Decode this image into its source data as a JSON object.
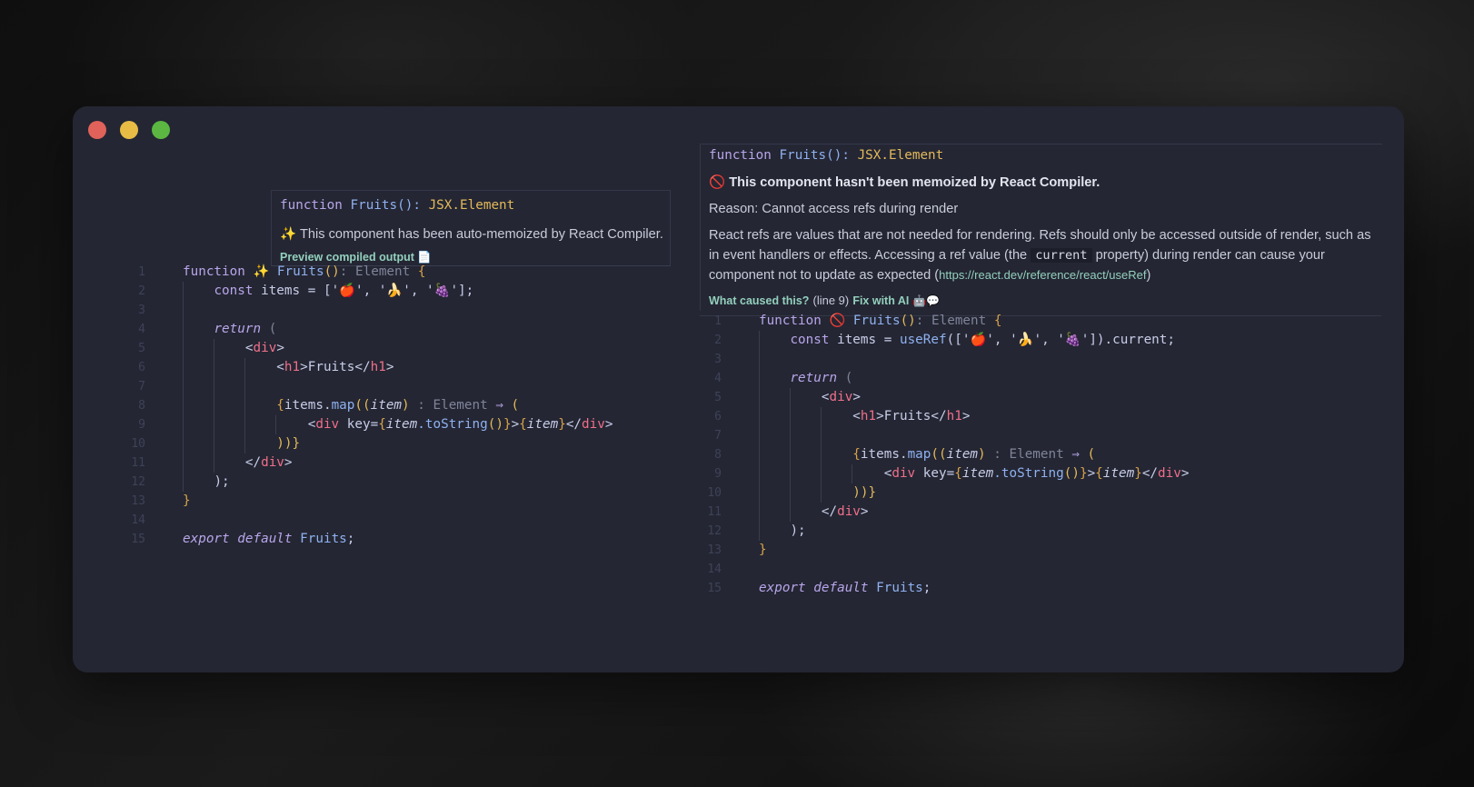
{
  "left_tooltip": {
    "signature": {
      "keyword": "function",
      "name": "Fruits",
      "parens": "()",
      "colon": ":",
      "type": "JSX.Element"
    },
    "message_icon": "✨",
    "message": "This component has been auto-memoized by React Compiler.",
    "link": "Preview compiled output",
    "link_icon": "📄"
  },
  "left_code": {
    "line_numbers": [
      "1",
      "2",
      "3",
      "4",
      "5",
      "6",
      "7",
      "8",
      "9",
      "10",
      "11",
      "12",
      "13",
      "14",
      "15"
    ],
    "marker": "✨"
  },
  "right_tooltip": {
    "signature": {
      "keyword": "function",
      "name": "Fruits",
      "parens": "()",
      "colon": ":",
      "type": "JSX.Element"
    },
    "title_icon": "🚫",
    "title": "This component hasn't been memoized by React Compiler.",
    "reason": "Reason: Cannot access refs during render",
    "desc_line1": "React refs are values that are not needed for rendering. Refs should only be accessed outside of render, such as",
    "desc_line2_a": "in event handlers or effects. Accessing a ref value (the ",
    "desc_line2_code": "current",
    "desc_line2_b": " property) during render can cause your",
    "desc_line3_a": "component not to update as expected (",
    "desc_line3_url": "https://react.dev/reference/react/useRef",
    "desc_line3_b": ")",
    "link_cause": "What caused this?",
    "line_ref": "(line 9)",
    "link_fix": "Fix with AI",
    "fix_icons": "🤖💬"
  },
  "right_code": {
    "line_numbers": [
      "1",
      "2",
      "3",
      "4",
      "5",
      "6",
      "7",
      "8",
      "9",
      "10",
      "11",
      "12",
      "13",
      "14",
      "15"
    ],
    "marker": "🚫"
  },
  "code": {
    "kw_function": "function",
    "fn_name": "Fruits",
    "paren_open": "(",
    "paren_close": ")",
    "type_hint": ": Element",
    "brace_open": "{",
    "brace_close": "}",
    "kw_const": "const",
    "items": "items",
    "eq": " = ",
    "array_left": "['🍎', '🍌', '🍇'];",
    "useRef": "useRef",
    "array_right": "(['🍎', '🍌', '🍇']).current;",
    "kw_return": "return",
    "ret_paren": " (",
    "div_open_lt": "<",
    "div": "div",
    "gt": ">",
    "h1_lt": "<",
    "h1": "h1",
    "h1_text": "Fruits",
    "close_lt": "</",
    "map_open": "{",
    "map_items": "items",
    "dot": ".",
    "map": "map",
    "map_paren": "((",
    "item": "item",
    "map_paren_close": ")",
    "map_type": " : Element ",
    "arrow": "⇒",
    "map_paren_open2": " (",
    "key_attr": " key=",
    "item_to": "item",
    "to_string": ".toString",
    "call": "()",
    "close_paren_brace": "))}",
    "stmt_end": ");",
    "kw_export": "export",
    "kw_default": "default",
    "semicolon": ";"
  }
}
